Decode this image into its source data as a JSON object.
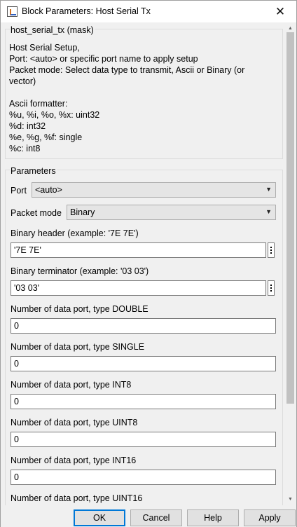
{
  "window": {
    "title": "Block Parameters: Host Serial Tx",
    "close_glyph": "✕"
  },
  "mask": {
    "legend": "host_serial_tx (mask)",
    "description_lines": [
      "Host Serial Setup,",
      "Port: <auto> or specific port name to apply setup",
      "Packet mode: Select data type to transmit, Ascii or Binary (or",
      "vector)",
      "",
      "Ascii formatter:",
      "%u, %i, %o, %x: uint32",
      "%d: int32",
      "%e, %g, %f: single",
      "%c: int8"
    ]
  },
  "parameters": {
    "legend": "Parameters",
    "port": {
      "label": "Port",
      "value": "<auto>"
    },
    "packet_mode": {
      "label": "Packet mode",
      "value": "Binary"
    },
    "binary_header": {
      "label": "Binary header (example: '7E 7E')",
      "value": "'7E 7E'"
    },
    "binary_terminator": {
      "label": "Binary terminator (example: '03 03')",
      "value": "'03 03'"
    },
    "data_ports": [
      {
        "label": "Number of data port, type DOUBLE",
        "value": "0"
      },
      {
        "label": "Number of data port, type SINGLE",
        "value": "0"
      },
      {
        "label": "Number of data port, type INT8",
        "value": "0"
      },
      {
        "label": "Number of data port, type UINT8",
        "value": "0"
      },
      {
        "label": "Number of data port, type INT16",
        "value": "0"
      },
      {
        "label": "Number of data port, type UINT16",
        "value": ""
      }
    ]
  },
  "buttons": {
    "ok": "OK",
    "cancel": "Cancel",
    "help": "Help",
    "apply": "Apply"
  },
  "icons": {
    "app": "block-parameters-icon",
    "close": "close-icon",
    "dropdown": "chevron-down-icon",
    "more": "more-options-icon",
    "scroll_up": "scroll-up-arrow-icon",
    "scroll_down": "scroll-down-arrow-icon"
  },
  "colors": {
    "default_button_border": "#0078d7",
    "window_background": "#f0f0f0"
  }
}
